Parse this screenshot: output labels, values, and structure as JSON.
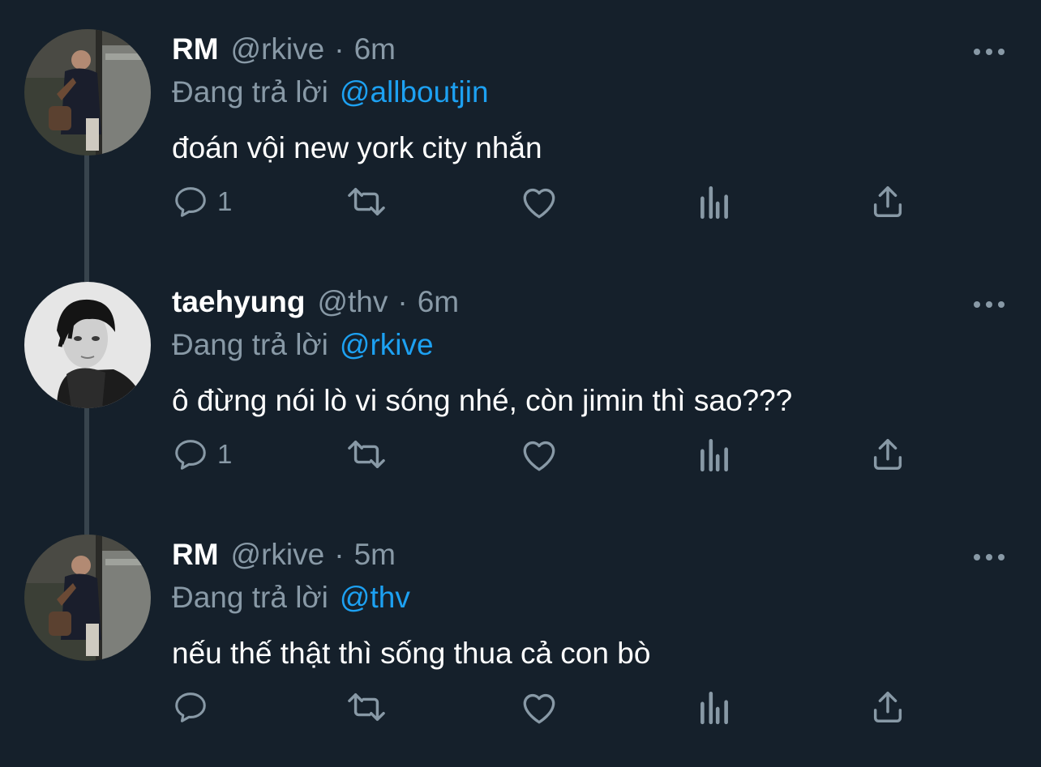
{
  "theme": {
    "background": "#15202b",
    "text": "#ffffff",
    "muted": "#8899a6",
    "accent": "#1da1f2",
    "thread_line": "#38444d"
  },
  "tweets": [
    {
      "name": "RM",
      "handle": "@rkive",
      "separator": "·",
      "time": "6m",
      "replying_prefix": "Đang trả lời",
      "replying_to": "@allboutjin",
      "text": "đoán vội new york city nhắn",
      "reply_count": "1",
      "avatar": "rm-avatar"
    },
    {
      "name": "taehyung",
      "handle": "@thv",
      "separator": "·",
      "time": "6m",
      "replying_prefix": "Đang trả lời",
      "replying_to": "@rkive",
      "text": "ô đừng nói lò vi sóng nhé, còn jimin thì sao???",
      "reply_count": "1",
      "avatar": "taehyung-avatar"
    },
    {
      "name": "RM",
      "handle": "@rkive",
      "separator": "·",
      "time": "5m",
      "replying_prefix": "Đang trả lời",
      "replying_to": "@thv",
      "text": "nếu thế thật thì sống thua cả con bò",
      "reply_count": "",
      "avatar": "rm-avatar"
    }
  ],
  "icons": {
    "reply": "reply-icon",
    "retweet": "retweet-icon",
    "like": "heart-icon",
    "analytics": "analytics-icon",
    "share": "share-icon",
    "more": "more-icon"
  }
}
